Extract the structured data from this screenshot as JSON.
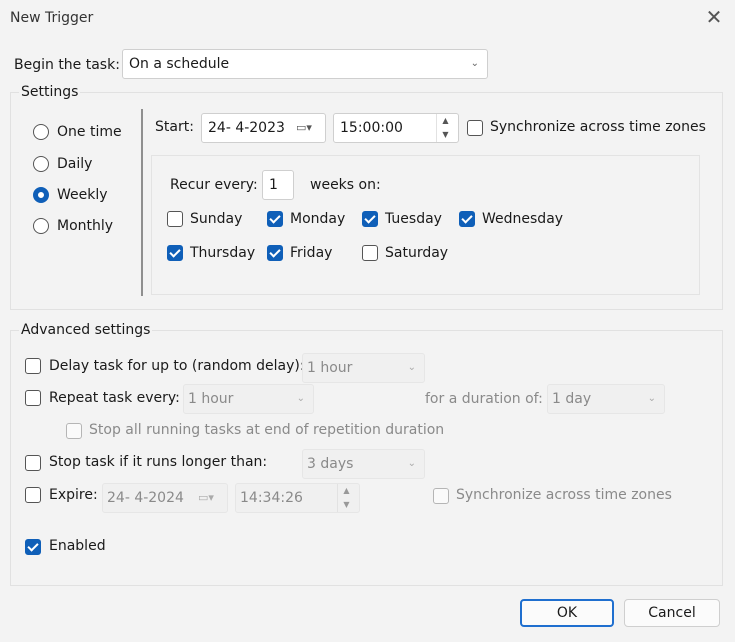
{
  "window": {
    "title": "New Trigger",
    "close_glyph": "✕"
  },
  "begin": {
    "label": "Begin the task:",
    "value": "On a schedule"
  },
  "settings": {
    "label": "Settings",
    "frequency": [
      {
        "label": "One time",
        "checked": false
      },
      {
        "label": "Daily",
        "checked": false
      },
      {
        "label": "Weekly",
        "checked": true
      },
      {
        "label": "Monthly",
        "checked": false
      }
    ],
    "start_label": "Start:",
    "start_date": "24- 4-2023",
    "start_time": "15:00:00",
    "sync_label": "Synchronize across time zones",
    "sync_checked": false,
    "recur_label": "Recur every:",
    "recur_value": "1",
    "weeks_on_label": "weeks on:",
    "days": [
      {
        "label": "Sunday",
        "checked": false
      },
      {
        "label": "Monday",
        "checked": true
      },
      {
        "label": "Tuesday",
        "checked": true
      },
      {
        "label": "Wednesday",
        "checked": true
      },
      {
        "label": "Thursday",
        "checked": true
      },
      {
        "label": "Friday",
        "checked": true
      },
      {
        "label": "Saturday",
        "checked": false
      }
    ]
  },
  "advanced": {
    "label": "Advanced settings",
    "delay_label": "Delay task for up to (random delay):",
    "delay_value": "1 hour",
    "repeat_label": "Repeat task every:",
    "repeat_value": "1 hour",
    "duration_label": "for a duration of:",
    "duration_value": "1 day",
    "stop_all_label": "Stop all running tasks at end of repetition duration",
    "stop_longer_label": "Stop task if it runs longer than:",
    "stop_longer_value": "3 days",
    "expire_label": "Expire:",
    "expire_date": "24- 4-2024",
    "expire_time": "14:34:26",
    "expire_sync_label": "Synchronize across time zones",
    "enabled_label": "Enabled",
    "enabled_checked": true
  },
  "buttons": {
    "ok": "OK",
    "cancel": "Cancel"
  },
  "icons": {
    "chevron": "⌄",
    "calendar": "▭▾",
    "spin_up": "▲",
    "spin_down": "▼"
  }
}
